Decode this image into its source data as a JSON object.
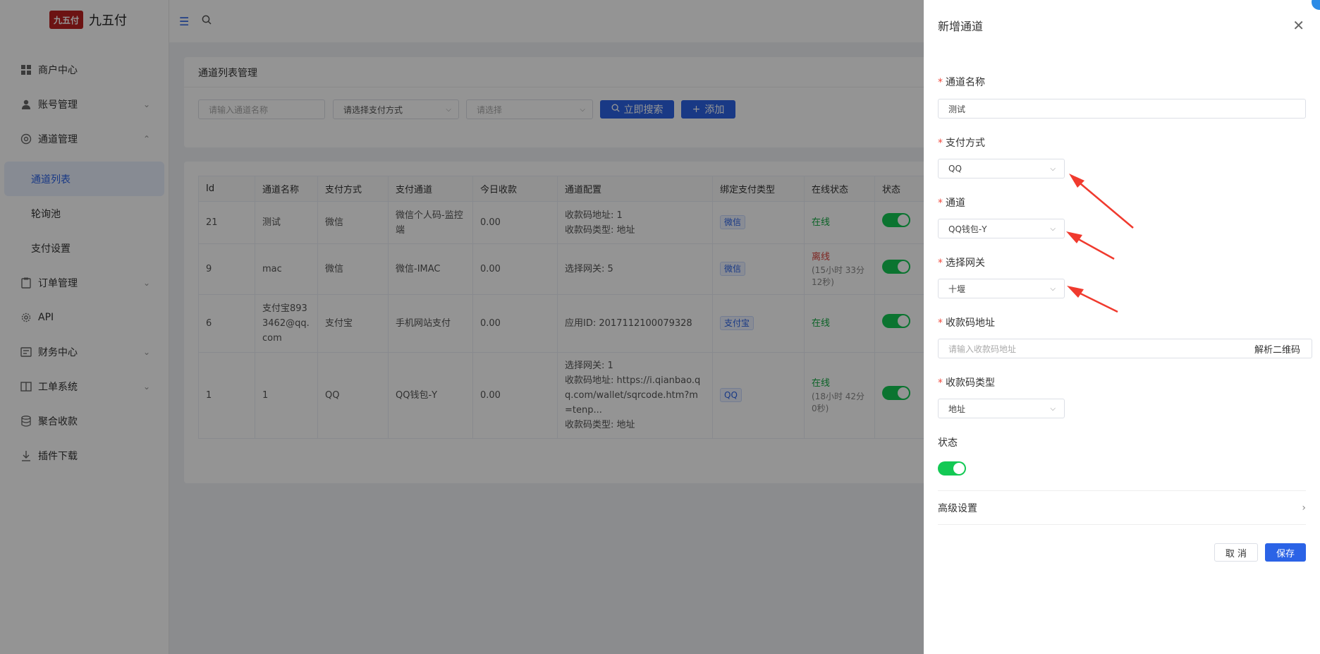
{
  "sidebar": {
    "logo_mark": "九五付",
    "logo_text": "九五付",
    "items": [
      {
        "label": "商户中心"
      },
      {
        "label": "账号管理"
      },
      {
        "label": "通道管理"
      },
      {
        "label": "通道列表"
      },
      {
        "label": "轮询池"
      },
      {
        "label": "支付设置"
      },
      {
        "label": "订单管理"
      },
      {
        "label": "API"
      },
      {
        "label": "财务中心"
      },
      {
        "label": "工单系统"
      },
      {
        "label": "聚合收款"
      },
      {
        "label": "插件下载"
      }
    ]
  },
  "main": {
    "filter_title": "通道列表管理",
    "name_placeholder": "请输入通道名称",
    "pay_method_placeholder": "请选择支付方式",
    "select_placeholder": "请选择",
    "search_label": "立即搜索",
    "add_label": "添加"
  },
  "table": {
    "headers": [
      "Id",
      "通道名称",
      "支付方式",
      "支付通道",
      "今日收款",
      "通道配置",
      "绑定支付类型",
      "在线状态",
      "状态"
    ],
    "rows": [
      {
        "id": "21",
        "name": "测试",
        "method": "微信",
        "channel": "微信个人码-监控端",
        "today": "0.00",
        "config1": "收款码地址: 1",
        "config2": "收款码类型: 地址",
        "config3": "",
        "bind": "微信",
        "status": "在线",
        "status_sub": ""
      },
      {
        "id": "9",
        "name": "mac",
        "method": "微信",
        "channel": "微信-IMAC",
        "today": "0.00",
        "config1": "选择网关: 5",
        "config2": "",
        "config3": "",
        "bind": "微信",
        "status": "离线",
        "status_sub": "(15小时 33分 12秒)"
      },
      {
        "id": "6",
        "name": "支付宝8933462@qq.com",
        "method": "支付宝",
        "channel": "手机网站支付",
        "today": "0.00",
        "config1": "应用ID: 2017112100079328",
        "config2": "",
        "config3": "",
        "bind": "支付宝",
        "status": "在线",
        "status_sub": ""
      },
      {
        "id": "1",
        "name": "1",
        "method": "QQ",
        "channel": "QQ钱包-Y",
        "today": "0.00",
        "config1": "选择网关: 1",
        "config2": "收款码地址: https://i.qianbao.qq.com/wallet/sqrcode.htm?m=tenp...",
        "config3": "收款码类型: 地址",
        "bind": "QQ",
        "status": "在线",
        "status_sub": "(18小时 42分 0秒)"
      }
    ]
  },
  "drawer": {
    "title": "新增通道",
    "name_label": "通道名称",
    "name_value": "测试",
    "pay_method_label": "支付方式",
    "pay_method_value": "QQ",
    "channel_label": "通道",
    "channel_value": "QQ钱包-Y",
    "gateway_label": "选择网关",
    "gateway_value": "十堰",
    "qr_url_label": "收款码地址",
    "qr_url_placeholder": "请输入收款码地址",
    "parse_qr_label": "解析二维码",
    "qr_type_label": "收款码类型",
    "qr_type_value": "地址",
    "status_label": "状态",
    "advanced_label": "高级设置",
    "cancel_label": "取 消",
    "save_label": "保存"
  },
  "colors": {
    "primary": "#2b63e6",
    "online": "#13a943",
    "offline": "#d9403a",
    "toggle_on": "#13c954",
    "annotation_arrow": "#f03a2e"
  }
}
